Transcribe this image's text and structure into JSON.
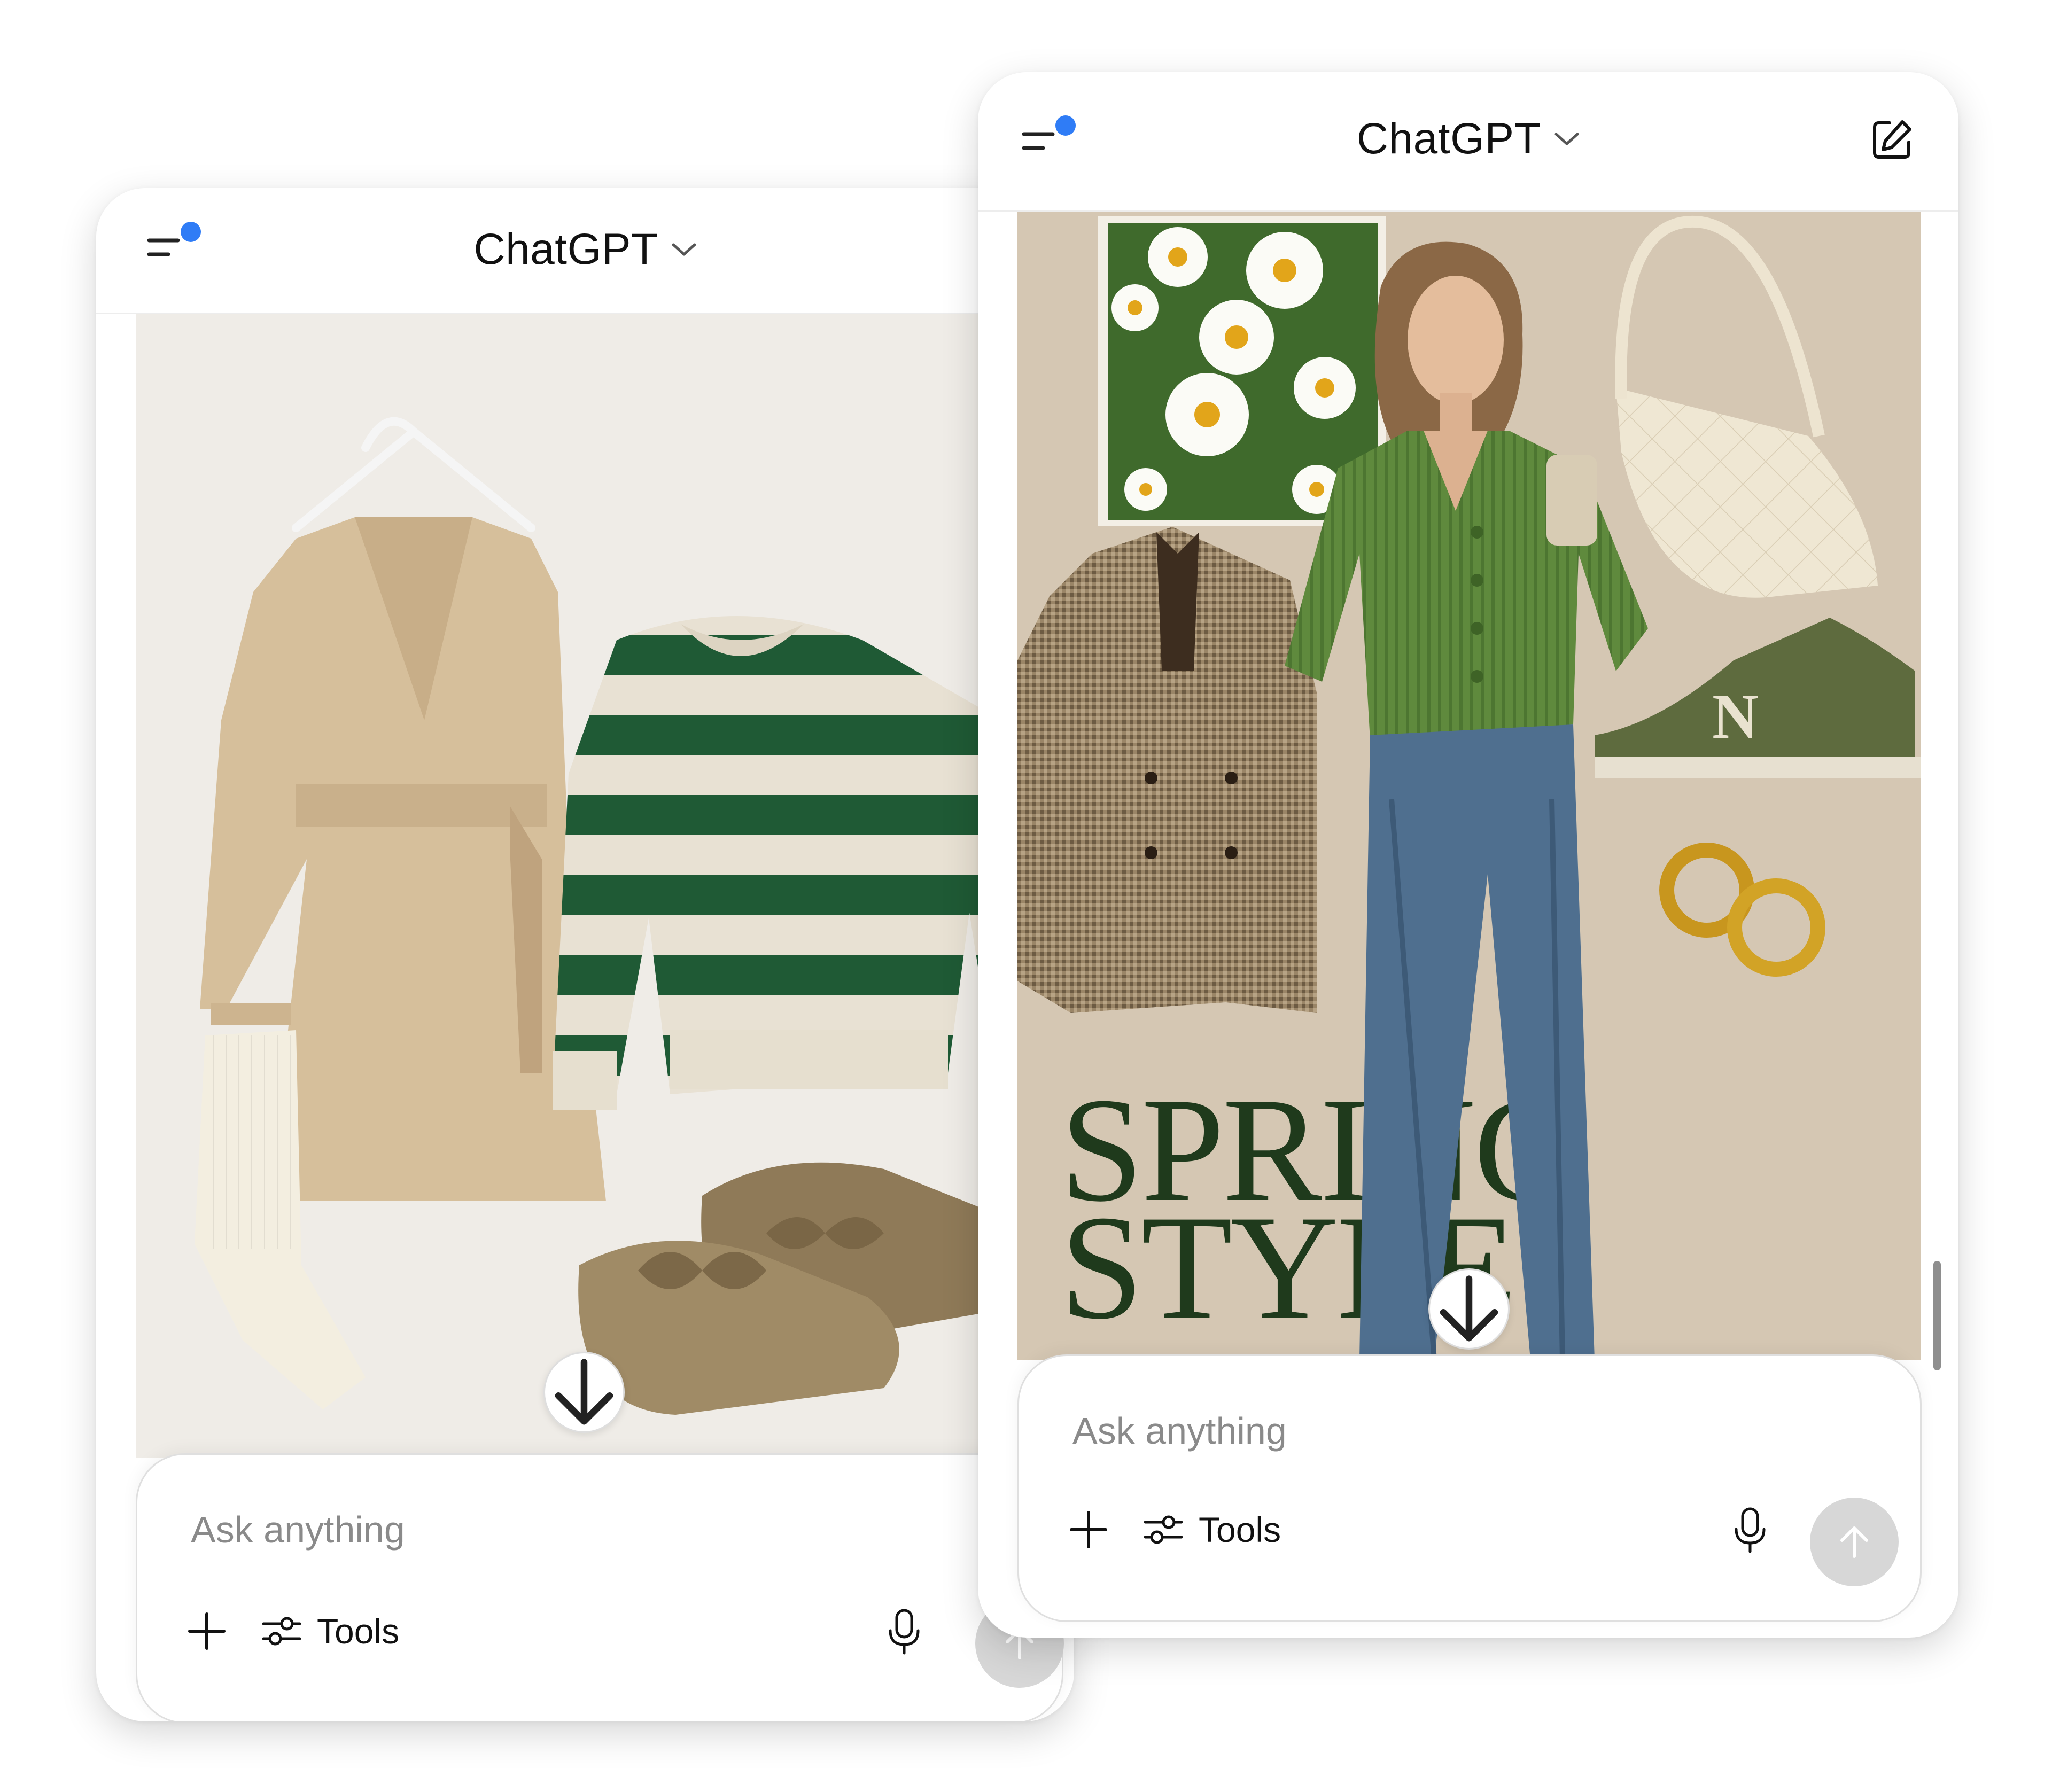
{
  "app": {
    "title": "ChatGPT",
    "accent_color": "#2f7cf6"
  },
  "left_window": {
    "header": {
      "title": "ChatGPT",
      "menu_icon": "sidebar-menu-icon",
      "chevron_icon": "chevron-down-icon"
    },
    "image": {
      "background_color": "#efece7"
    },
    "composer": {
      "placeholder": "Ask anything",
      "tools_label": "Tools",
      "icons": [
        "plus-icon",
        "tools-sliders-icon",
        "microphone-icon",
        "arrow-up-icon"
      ]
    }
  },
  "right_window": {
    "header": {
      "title": "ChatGPT",
      "menu_icon": "sidebar-menu-icon",
      "chevron_icon": "chevron-down-icon",
      "edit_icon": "new-chat-icon"
    },
    "image": {
      "background_color": "#d5c7b3",
      "headline_line1": "SPRING",
      "headline_line2": "STYLE",
      "headline_color": "#1f3a1c",
      "brand_letter": "N"
    },
    "composer": {
      "placeholder": "Ask anything",
      "tools_label": "Tools",
      "icons": [
        "plus-icon",
        "tools-sliders-icon",
        "microphone-icon",
        "arrow-up-icon"
      ]
    }
  }
}
